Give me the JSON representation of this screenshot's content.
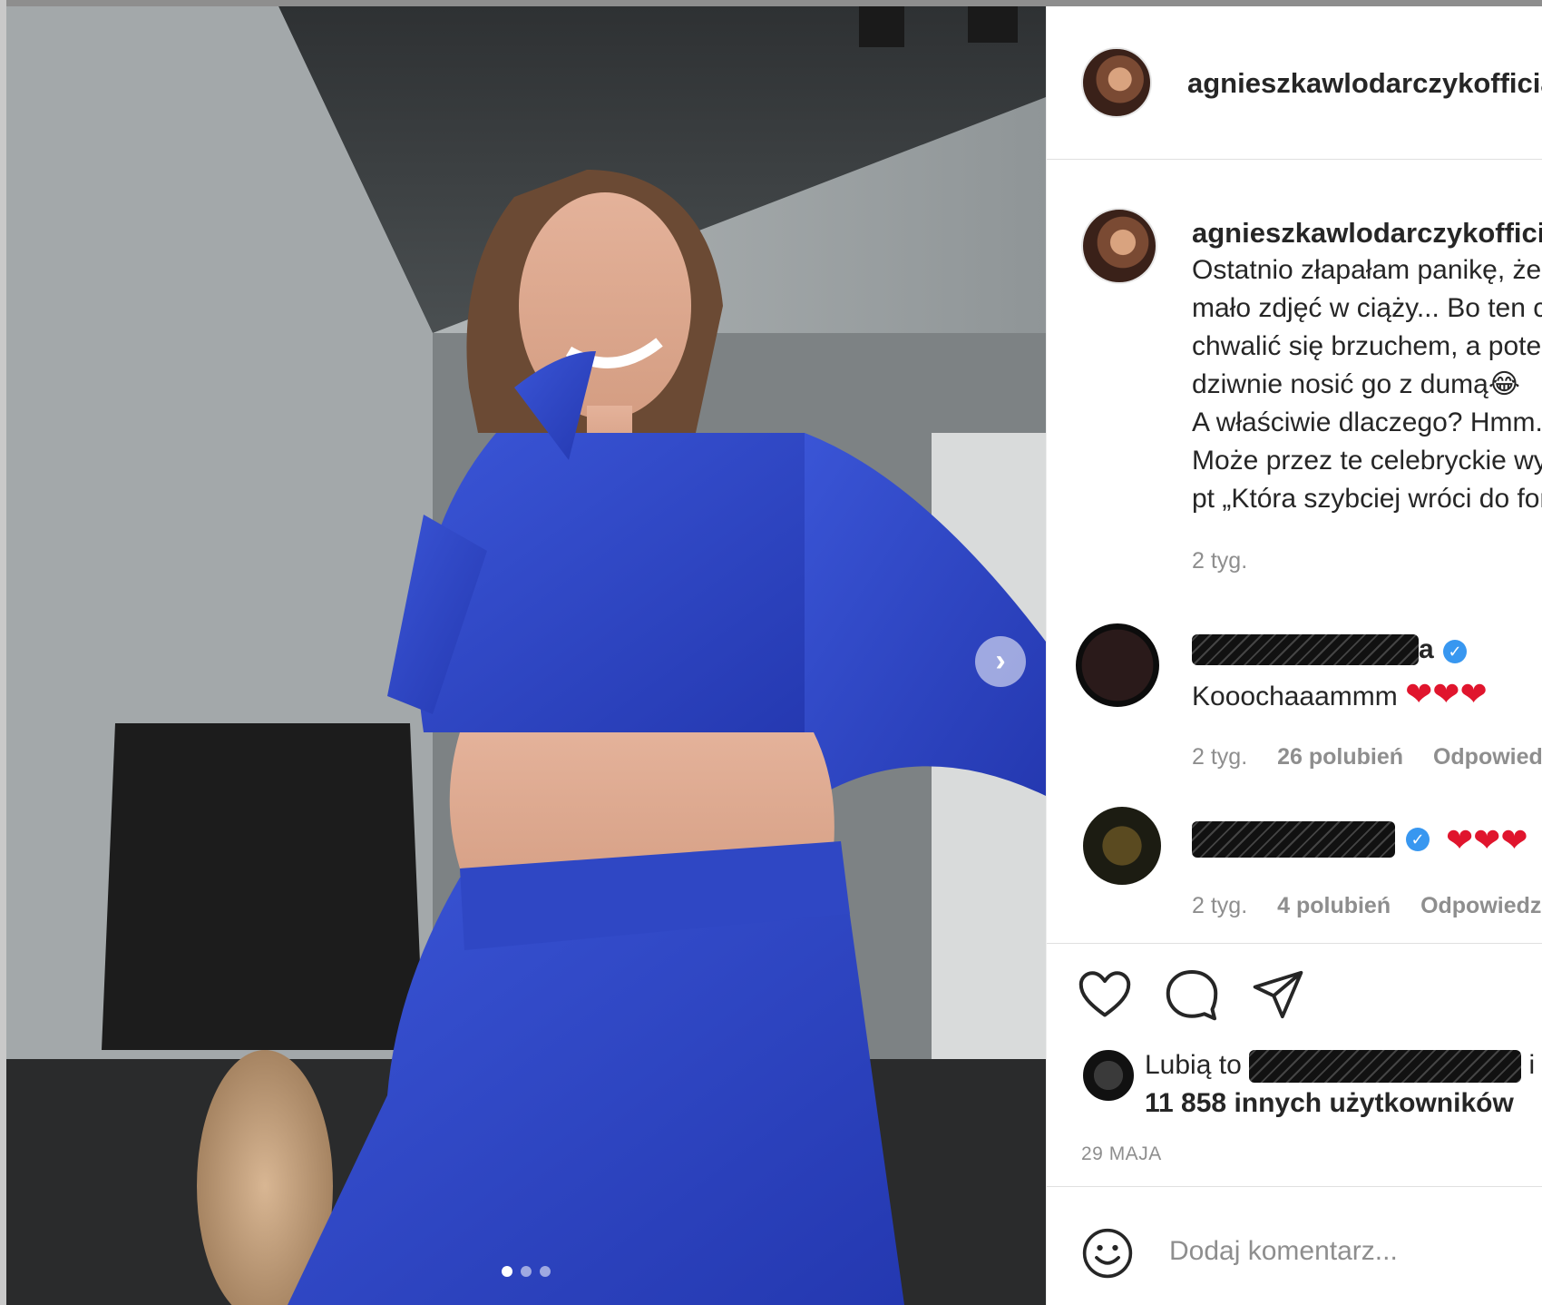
{
  "post": {
    "username": "agnieszkawlodarczykofficial",
    "caption_lines": [
      "Ostatnio złapałam panikę, że mam",
      "mało zdjęć w ciąży... Bo ten czas",
      "chwalić się brzuchem, a potem",
      "dziwnie nosić go z dumą😂",
      "A właściwie dlaczego? Hmm...",
      "Może przez te celebryckie wyścigi",
      "pt „Która szybciej wróci do formy”"
    ],
    "caption_time": "2 tyg.",
    "likes_prefix": "Lubią to",
    "likes_suffix": "i",
    "likes_count": "11 858 innych użytkowników",
    "date": "29 MAJA",
    "add_comment_placeholder": "Dodaj komentarz..."
  },
  "comments": [
    {
      "name_tail": "a",
      "text": "Kooochaaammm",
      "hearts": "❤❤❤",
      "time": "2 tyg.",
      "likes": "26 polubień",
      "reply": "Odpowiedz"
    },
    {
      "text": "",
      "hearts": "❤❤❤",
      "time": "2 tyg.",
      "likes": "4 polubień",
      "reply": "Odpowiedz"
    }
  ],
  "carousel": {
    "next_icon": "chevron-right-icon",
    "slides": 3,
    "active": 1
  },
  "icons": {
    "like": "heart-icon",
    "comment": "comment-icon",
    "share": "paper-plane-icon",
    "emoji": "smiley-icon",
    "verified": "verified-badge-icon"
  },
  "colors": {
    "link_blue": "#3897f0",
    "heart_red": "#e0152d",
    "muted": "#8e8e8e"
  }
}
